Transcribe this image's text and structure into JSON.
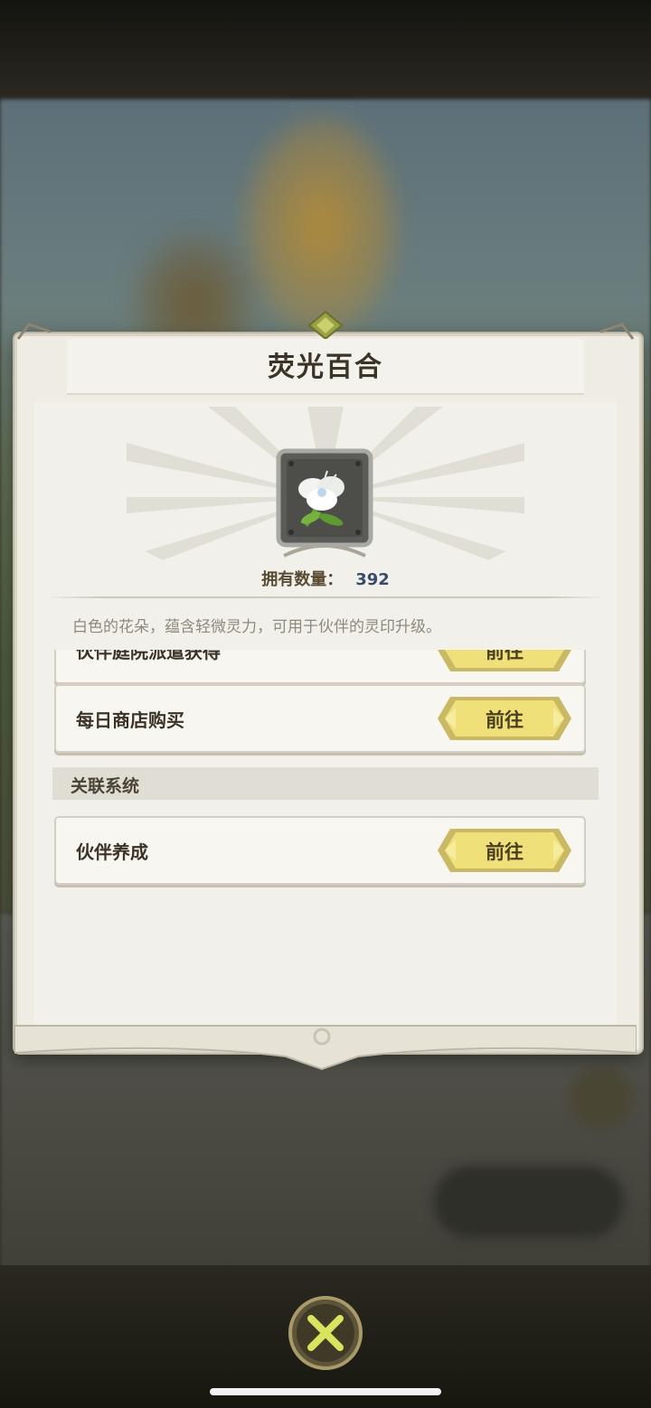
{
  "dialog": {
    "title": "荧光百合",
    "item_icon": "white-lily-flower-icon",
    "quantity_label": "拥有数量：",
    "quantity_value": "392",
    "description": "白色的花朵，蕴含轻微灵力，可用于伙伴的灵印升级。"
  },
  "sources": [
    {
      "label": "伙伴庭院派遣获得",
      "button": "前往"
    },
    {
      "label": "每日商店购买",
      "button": "前往"
    }
  ],
  "related_section": {
    "title": "关联系统"
  },
  "related": [
    {
      "label": "伙伴养成",
      "button": "前往"
    }
  ],
  "close_icon": "close-x-icon",
  "colors": {
    "button_gold": "#efe07a",
    "panel": "#efece3",
    "title_text": "#3b3426"
  }
}
